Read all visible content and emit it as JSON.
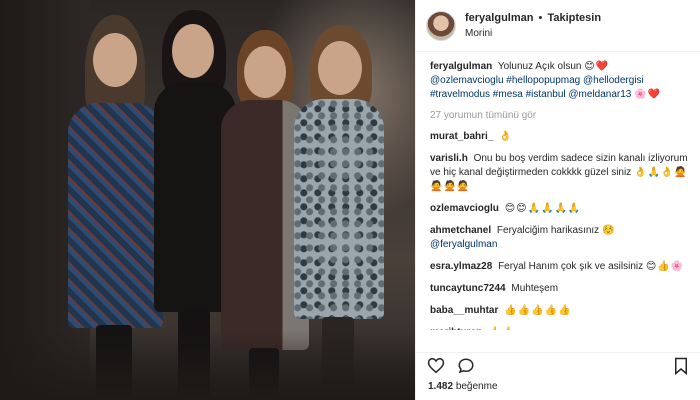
{
  "header": {
    "username": "feryalgulman",
    "separator": "•",
    "follow_status": "Takiptesin",
    "location": "Morini"
  },
  "caption": {
    "username": "feryalgulman",
    "text": "Yolunuz Açık olsun",
    "emoji": "😊❤️",
    "tags": "@ozlemavcioglu #hellopopupmag @hellodergisi #travelmodus #mesa #istanbul @meldanar13",
    "tags_emoji": "🌸❤️"
  },
  "view_all_comments": "27 yorumun tümünü gör",
  "comments": [
    {
      "user": "murat_bahri_",
      "text": "",
      "emoji": "👌"
    },
    {
      "user": "varisli.h",
      "text": "Onu bu boş verdim sadece sizin kanalı izliyorum ve hiç kanal değiştirmeden cokkkk güzel siniz",
      "emoji": "👌🙏👌🙅🙅🙅🙅"
    },
    {
      "user": "ozlemavcioglu",
      "text": "",
      "emoji": "😊😊🙏🙏🙏🙏"
    },
    {
      "user": "ahmetchanel",
      "text": "Feryalciğim harikasınız",
      "tag": "@feryalgulman",
      "emoji": "☺️"
    },
    {
      "user": "esra.ylmaz28",
      "text": "Feryal Hanım çok şık ve asilsiniz",
      "emoji": "😊👍🌸"
    },
    {
      "user": "tuncaytunc7244",
      "text": "Muhteşem",
      "emoji": ""
    },
    {
      "user": "baba__muhtar",
      "text": "",
      "emoji": "👍👍👍👍👍"
    },
    {
      "user": "merihturan",
      "text": "",
      "emoji": "👍👍"
    }
  ],
  "likes": {
    "count": "1.482",
    "label": "beğenme"
  },
  "icons": {
    "like": "heart-outline-icon",
    "comment": "speech-bubble-icon",
    "save": "bookmark-icon"
  },
  "colors": {
    "link": "#003569",
    "muted": "#999999",
    "text": "#262626",
    "border": "#efefef"
  }
}
